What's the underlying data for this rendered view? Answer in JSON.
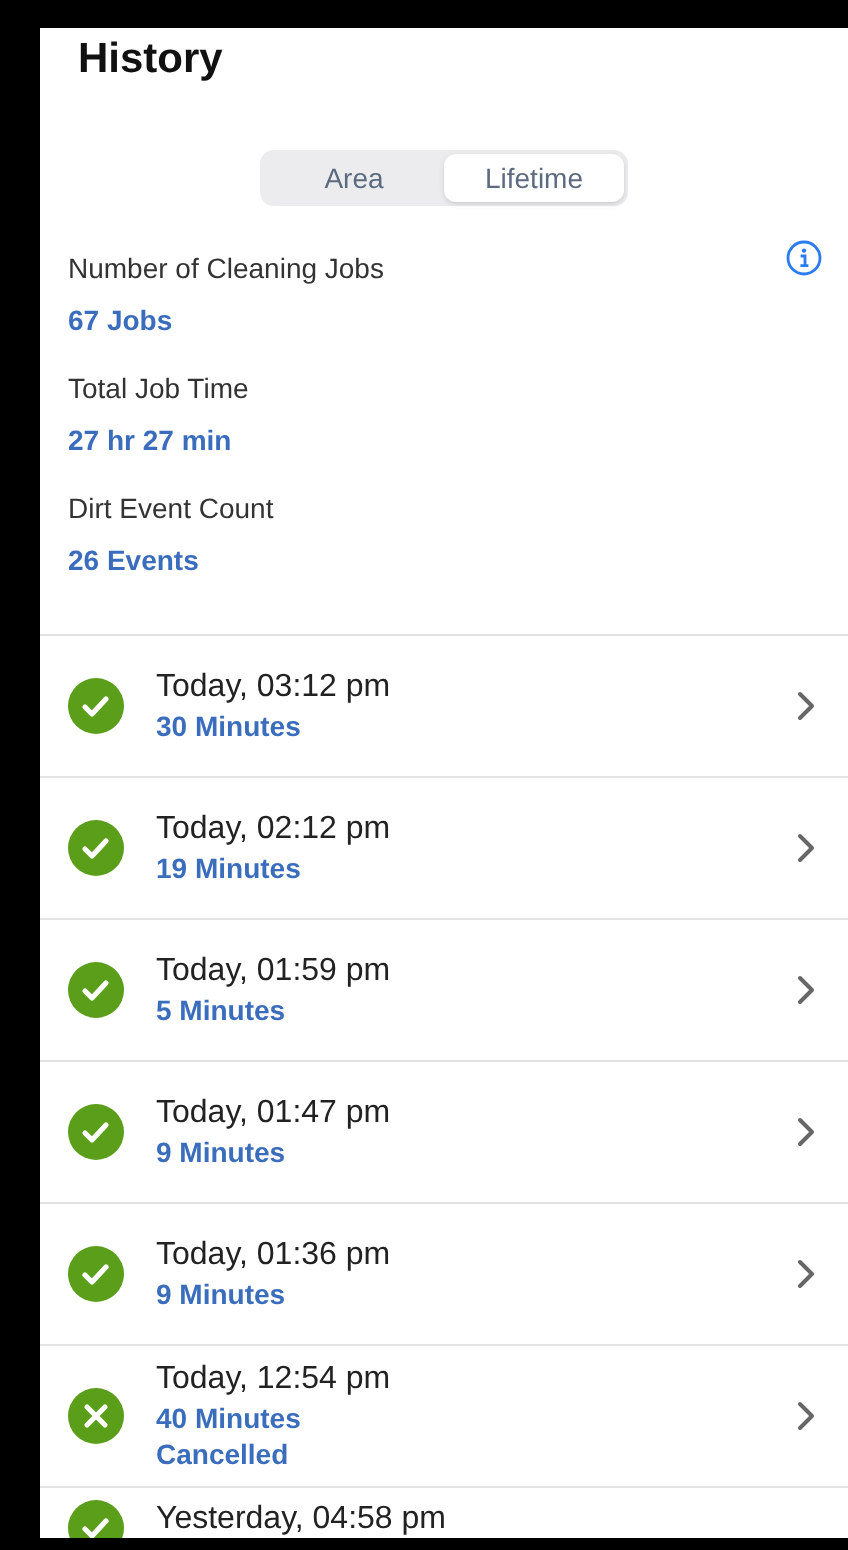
{
  "title": "History",
  "tabs": [
    {
      "label": "Area",
      "selected": false
    },
    {
      "label": "Lifetime",
      "selected": true
    }
  ],
  "stats": [
    {
      "label": "Number of Cleaning Jobs",
      "value": "67 Jobs"
    },
    {
      "label": "Total Job Time",
      "value": "27 hr 27 min"
    },
    {
      "label": "Dirt Event Count",
      "value": "26 Events"
    }
  ],
  "jobs": [
    {
      "kind": "done",
      "time": "Today, 03:12 pm",
      "duration": "30 Minutes"
    },
    {
      "kind": "done",
      "time": "Today, 02:12 pm",
      "duration": "19 Minutes"
    },
    {
      "kind": "done",
      "time": "Today, 01:59 pm",
      "duration": "5 Minutes"
    },
    {
      "kind": "done",
      "time": "Today, 01:47 pm",
      "duration": "9 Minutes"
    },
    {
      "kind": "done",
      "time": "Today, 01:36 pm",
      "duration": "9 Minutes"
    },
    {
      "kind": "cancelled",
      "time": "Today, 12:54 pm",
      "duration": "40 Minutes",
      "status": "Cancelled"
    },
    {
      "kind": "done",
      "time": "Yesterday, 04:58 pm"
    }
  ]
}
